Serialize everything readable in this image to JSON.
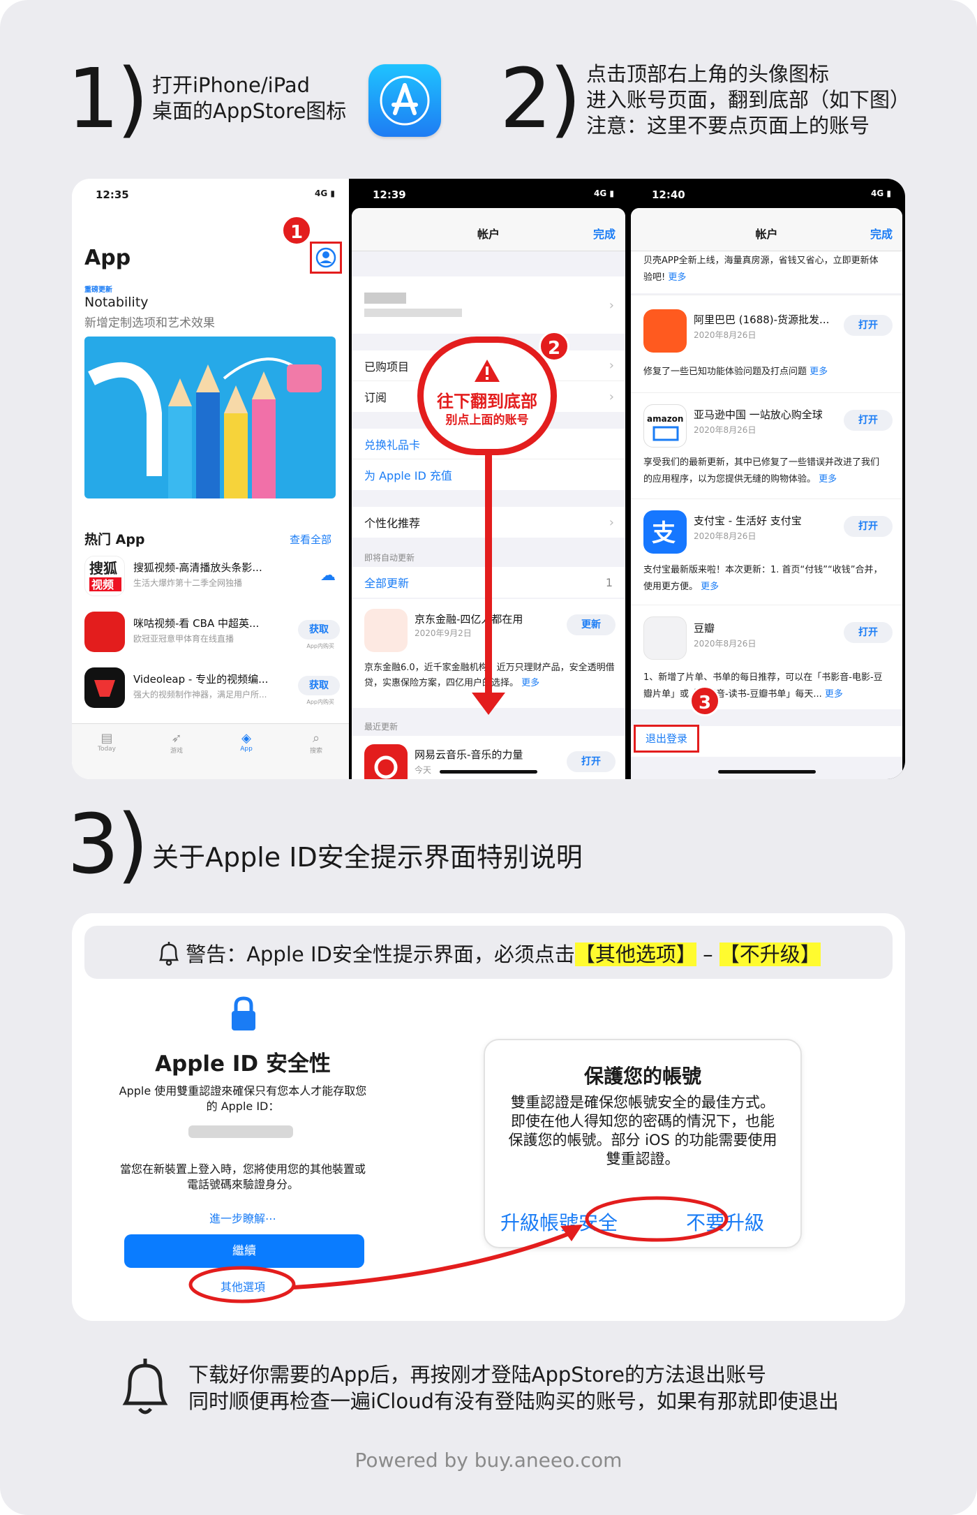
{
  "step1": {
    "num": "1)",
    "line1": "打开iPhone/iPad",
    "line2": "桌面的AppStore图标"
  },
  "step2": {
    "num": "2)",
    "line1": "点击顶部右上角的头像图标",
    "line2": "进入账号页面，翻到底部（如下图）",
    "line3": "注意：这里不要点页面上的账号"
  },
  "screen1": {
    "time": "12:35",
    "signal": "4G",
    "title": "App",
    "feature_tag": "重磅更新",
    "feature_title": "Notability",
    "feature_sub": "新增定制选项和艺术效果",
    "hot_title": "热门 App",
    "see_all": "查看全部",
    "apps": [
      {
        "name": "搜狐视频-高清播放头条影...",
        "desc": "生活大爆炸第十二季全网独播",
        "action": ""
      },
      {
        "name": "咪咕视频-看 CBA 中超英...",
        "desc": "欧冠亚冠意甲体育在线直播",
        "action": "获取",
        "note": "App内购买"
      },
      {
        "name": "Videoleap - 专业的视频编...",
        "desc": "强大的视频制作神器，满足用户所...",
        "action": "获取",
        "note": "App内购买"
      }
    ],
    "tabs": [
      "Today",
      "游戏",
      "App",
      "搜索"
    ],
    "badge": "1"
  },
  "screen2": {
    "time": "12:39",
    "signal": "4G",
    "header": "帐户",
    "done": "完成",
    "rows": [
      "已购项目",
      "订阅"
    ],
    "gift": "兑换礼品卡",
    "topup": "为 Apple ID 充值",
    "personal": "个性化推荐",
    "auto_caption": "即将自动更新",
    "update_all": "全部更新",
    "count": "1",
    "app_name": "京东金融-四亿人都在用",
    "app_date": "2020年9月2日",
    "app_action": "更新",
    "app_note": "京东金融6.0，近千家金融机构，近万只理财产品，安全透明借贷，实惠保险方案，四亿用户的选择。",
    "more": "更多",
    "recent_caption": "最近更新",
    "recent_name": "网易云音乐-音乐的力量",
    "recent_date": "今天",
    "recent_action": "打开",
    "callout_title": "往下翻到底部",
    "callout_sub": "别点上面的账号",
    "badge": "2"
  },
  "screen3": {
    "time": "12:40",
    "signal": "4G",
    "header": "帐户",
    "done": "完成",
    "top_note": "贝壳APP全新上线，海量真房源，省钱又省心，立即更新体验吧!",
    "more": "更多",
    "apps": [
      {
        "name": "阿里巴巴 (1688)-货源批发...",
        "date": "2020年8月26日",
        "action": "打开",
        "note": "修复了一些已知功能体验问题及打点问题"
      },
      {
        "name": "亚马逊中国 一站放心购全球",
        "date": "2020年8月26日",
        "action": "打开",
        "note": "享受我们的最新更新，其中已修复了一些错误并改进了我们的应用程序，以为您提供无缝的购物体验。"
      },
      {
        "name": "支付宝 - 生活好 支付宝",
        "date": "2020年8月26日",
        "action": "打开",
        "note": "支付宝最新版来啦！本次更新：1. 首页“付钱”“收钱”合并，使用更方便。"
      },
      {
        "name": "豆瓣",
        "date": "2020年8月26日",
        "action": "打开",
        "note": "1、新增了片单、书单的每日推荐，可以在「书影音-电影-豆瓣片单」或「书影音-读书-豆瓣书单」每天..."
      }
    ],
    "signout": "退出登录",
    "badge": "3"
  },
  "step3": {
    "num": "3)",
    "title": "关于Apple ID安全提示界面特别说明"
  },
  "warning": {
    "prefix": "警告：Apple ID安全性提示界面，必须点击",
    "opt1": "【其他选项】",
    "dash": " – ",
    "opt2": "【不升级】"
  },
  "appleid": {
    "title": "Apple ID 安全性",
    "desc1": "Apple 使用雙重認證來確保只有您本人才能存取您的 Apple ID：",
    "desc2": "當您在新裝置上登入時，您將使用您的其他裝置或電話號碼來驗證身分。",
    "learn": "進一步瞭解⋯",
    "continue": "繼續",
    "other": "其他選項"
  },
  "dialog": {
    "title": "保護您的帳號",
    "body": "雙重認證是確保您帳號安全的最佳方式。即使在他人得知您的密碼的情況下，也能保護您的帳號。部分 iOS 的功能需要使用雙重認證。",
    "upgrade": "升級帳號安全",
    "no_upgrade": "不要升級"
  },
  "footer": {
    "line1": "下载好你需要的App后，再按刚才登陆AppStore的方法退出账号",
    "line2": "同时顺便再检查一遍iCloud有没有登陆购买的账号，如果有那就即使退出",
    "powered": "Powered by buy.aneeo.com"
  },
  "colors": {
    "accent_red": "#e31d1d",
    "ios_blue": "#1a7cf5",
    "highlight": "#fffb2f"
  }
}
